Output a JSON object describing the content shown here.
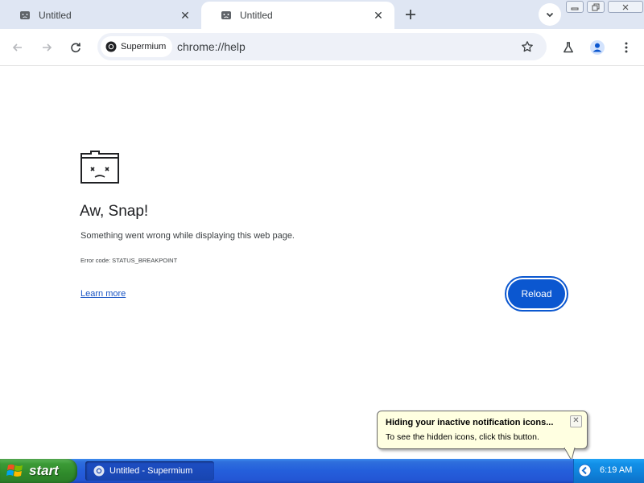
{
  "tabs": [
    {
      "title": "Untitled",
      "active": false
    },
    {
      "title": "Untitled",
      "active": true
    }
  ],
  "toolbar": {
    "site_chip": "Supermium",
    "url": "chrome://help"
  },
  "error_page": {
    "heading": "Aw, Snap!",
    "message": "Something went wrong while displaying this web page.",
    "error_code": "Error code: STATUS_BREAKPOINT",
    "learn_more": "Learn more",
    "reload_label": "Reload"
  },
  "balloon": {
    "title": "Hiding your inactive notification icons...",
    "text": "To see the hidden icons, click this button."
  },
  "taskbar": {
    "start_label": "start",
    "window_item": "Untitled - Supermium",
    "clock": "6:19 AM"
  },
  "colors": {
    "tabstrip_bg": "#dfe6f3",
    "accent_blue": "#0b57d0",
    "link_blue": "#1a55c4",
    "taskbar_blue": "#245edb",
    "start_green": "#3c9b37",
    "balloon_bg": "#ffffe1"
  },
  "icons": {
    "tab_favicon": "sad-face-icon",
    "new_tab": "plus-icon",
    "tab_search": "chevron-down-icon",
    "back": "arrow-left-icon",
    "forward": "arrow-right-icon",
    "reload": "reload-icon",
    "bookmark": "star-icon",
    "labs": "flask-icon",
    "profile": "person-icon",
    "menu": "three-dots-icon"
  }
}
